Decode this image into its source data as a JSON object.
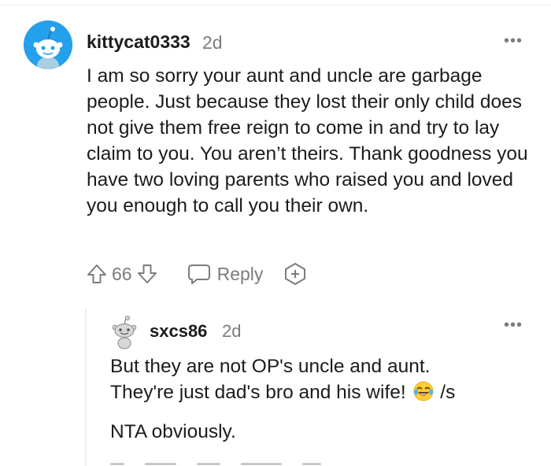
{
  "comment": {
    "avatar_icon": "snoo-avatar-icon",
    "avatar_color": "#24a0ed",
    "username": "kittycat0333",
    "timestamp": "2d",
    "more_label": "•••",
    "body": "I am so sorry your aunt and uncle are garbage people. Just because they lost their only child does not give them free reign to come in and try to lay claim to you. You aren’t theirs. Thank goodness you have two loving parents who raised you and loved you enough to call you their own.",
    "vote_count": "66",
    "reply_label": "Reply",
    "icons": {
      "upvote": "upvote-arrow-icon",
      "downvote": "downvote-arrow-icon",
      "reply": "speech-bubble-icon",
      "award": "award-plus-icon"
    }
  },
  "reply": {
    "avatar_icon": "snoo-avatar-icon",
    "username": "sxcs86",
    "timestamp": "2d",
    "more_label": "•••",
    "body_line1": "But they are not OP's uncle and aunt.",
    "body_line2_before": "They're just dad's bro and his wife! ",
    "emoji": "tears-of-joy-emoji",
    "body_line2_after": " /s",
    "body_line3": "NTA obviously."
  },
  "colors": {
    "text": "#1c1c1c",
    "meta": "#7c7c7c",
    "thread_line": "#edeff1"
  }
}
